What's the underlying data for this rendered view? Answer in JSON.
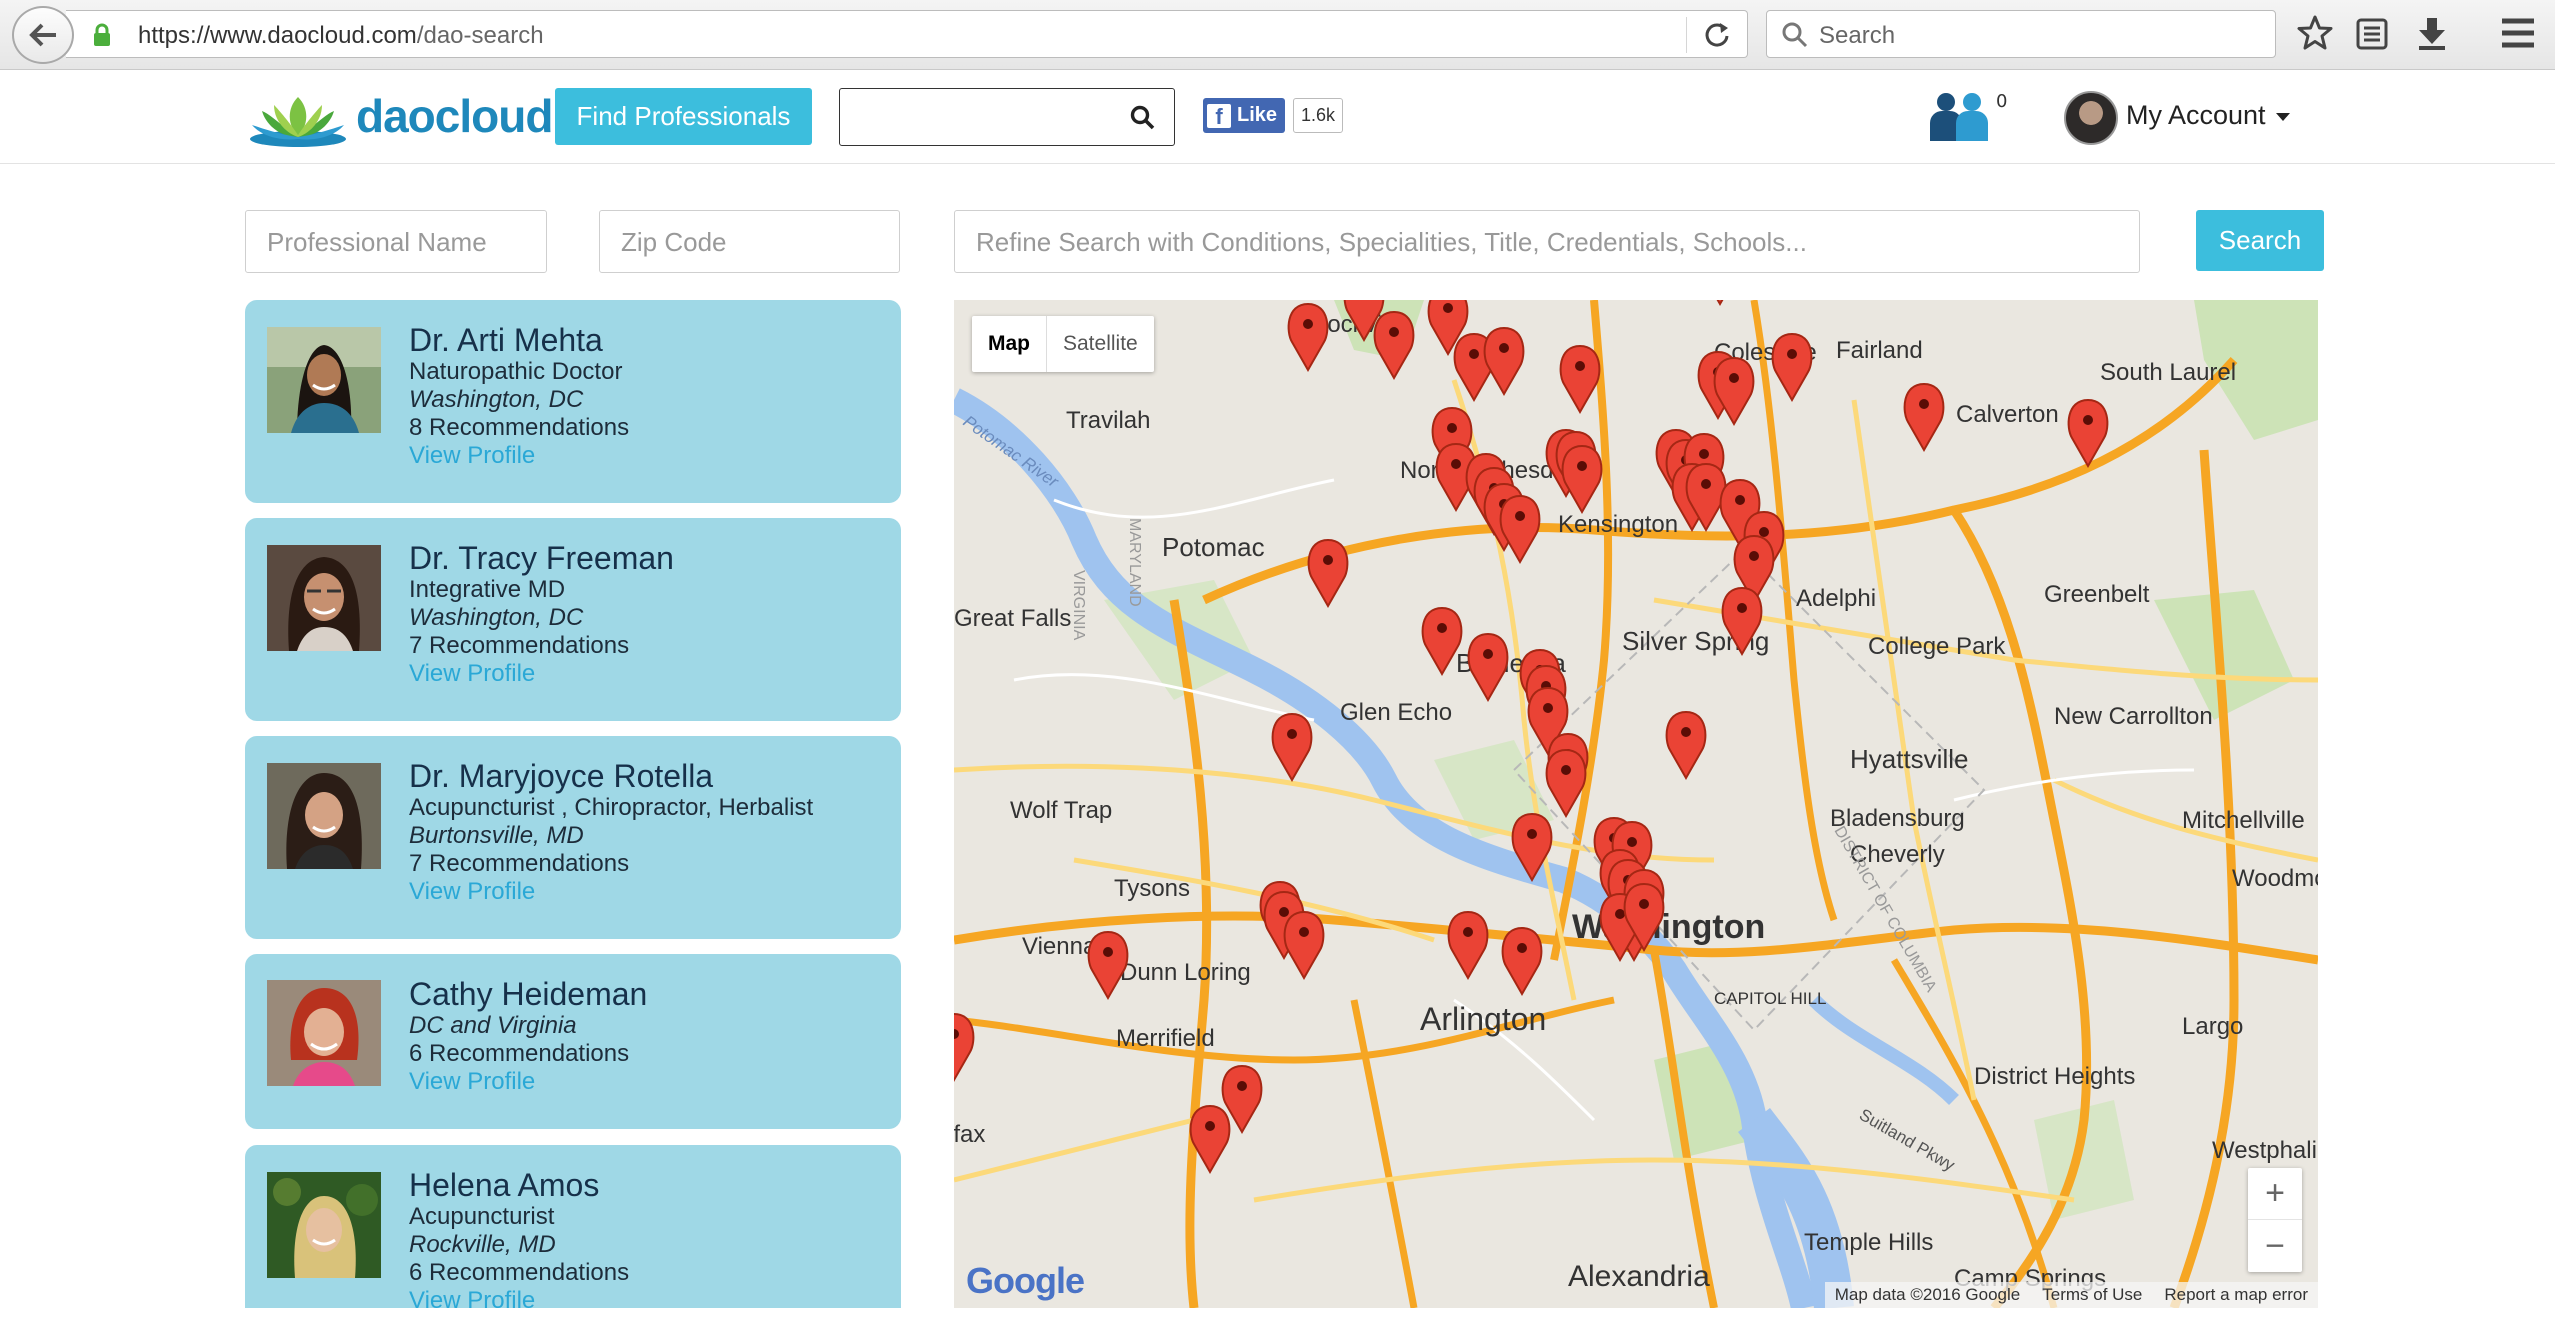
{
  "browser": {
    "url_domain": "https://www.daocloud.com",
    "url_path": "/dao-search",
    "search_placeholder": "Search"
  },
  "header": {
    "logo_text": "daocloud",
    "find_button": "Find Professionals",
    "search_value": "",
    "fb_like_label": "Like",
    "fb_like_count": "1.6k",
    "notification_count": "0",
    "account_label": "My Account"
  },
  "filters": {
    "name_placeholder": "Professional Name",
    "zip_placeholder": "Zip Code",
    "refine_placeholder": "Refine Search with Conditions, Specialities, Title, Credentials, Schools...",
    "search_button": "Search"
  },
  "professionals": [
    {
      "name": "Dr. Arti Mehta",
      "title": "Naturopathic Doctor",
      "location": "Washington, DC",
      "recommendations": "8 Recommendations",
      "link": "View Profile"
    },
    {
      "name": "Dr. Tracy Freeman",
      "title": "Integrative MD",
      "location": "Washington, DC",
      "recommendations": "7 Recommendations",
      "link": "View Profile"
    },
    {
      "name": "Dr. Maryjoyce Rotella",
      "title": "Acupuncturist , Chiropractor, Herbalist",
      "location": "Burtonsville, MD",
      "recommendations": "7 Recommendations",
      "link": "View Profile"
    },
    {
      "name": "Cathy Heideman",
      "title": "",
      "location": "DC and Virginia",
      "recommendations": "6 Recommendations",
      "link": "View Profile"
    },
    {
      "name": "Helena Amos",
      "title": "Acupuncturist",
      "location": "Rockville, MD",
      "recommendations": "6 Recommendations",
      "link": "View Profile"
    }
  ],
  "map": {
    "type_map": "Map",
    "type_satellite": "Satellite",
    "zoom_in": "+",
    "zoom_out": "−",
    "attribution": "Map data ©2016 Google",
    "terms": "Terms of Use",
    "report": "Report a map error",
    "google": "Google",
    "place_labels": [
      "Rockville",
      "Colesville",
      "Fairland",
      "South Laurel",
      "Travilah",
      "North Bethesda",
      "Calverton",
      "Kensington",
      "Potomac",
      "Adelphi",
      "Greenbelt",
      "Great Falls",
      "Silver Spring",
      "College Park",
      "Bethesda",
      "Glen Echo",
      "New Carrollton",
      "Hyattsville",
      "Wolf Trap",
      "Bladensburg",
      "Mitchellville",
      "Cheverly",
      "Tysons",
      "Woodmore",
      "Washington",
      "Vienna",
      "Dunn Loring",
      "Merrifield",
      "Arlington",
      "CAPITOL HILL",
      "Largo",
      "District Heights",
      "Fairfax",
      "Westphalia",
      "Temple Hills",
      "Alexandria",
      "Camp Springs",
      "VIRGINIA",
      "MARYLAND",
      "DISTRICT OF COLUMBIA",
      "Potomac River",
      "Suitland Pkwy"
    ]
  }
}
